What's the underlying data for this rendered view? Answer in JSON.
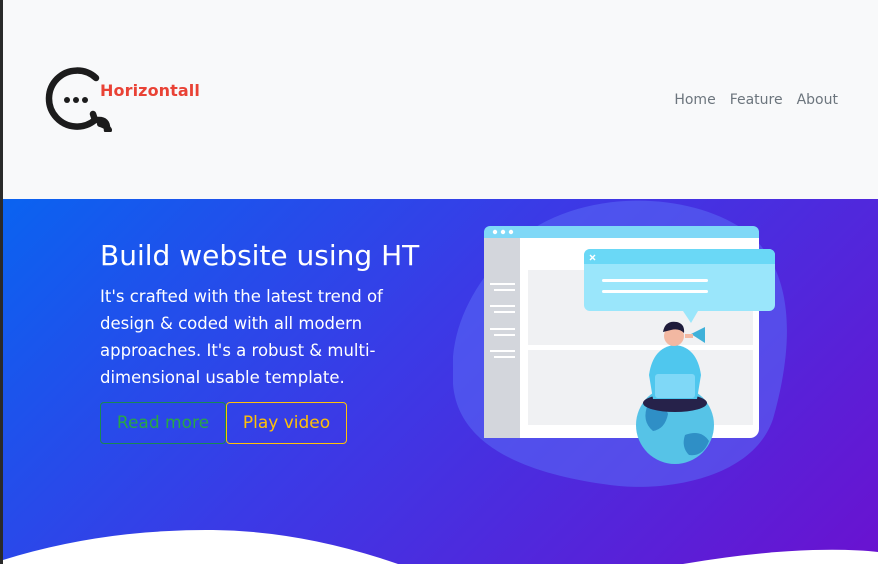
{
  "header": {
    "brand_name": "Horizontall",
    "logo_icon": "chat-bubble-ellipsis-icon",
    "nav_items": [
      {
        "label": "Home"
      },
      {
        "label": "Feature"
      },
      {
        "label": "About"
      }
    ]
  },
  "hero": {
    "title": "Build website using HT",
    "description": "It's crafted with the latest trend of design & coded with all modern approaches. It's a robust & multi-dimensional usable template.",
    "read_more_label": "Read more",
    "play_video_label": "Play video",
    "illustration_icon": "website-builder-illustration",
    "close_icon": "close-icon"
  },
  "colors": {
    "brand": "#e94235",
    "hero_gradient_start": "#0a63f0",
    "hero_gradient_end": "#6a12d0",
    "read_more": "#28a745",
    "play_video": "#ffc107",
    "nav_text": "#6c757d",
    "header_bg": "#f8f9fa"
  }
}
